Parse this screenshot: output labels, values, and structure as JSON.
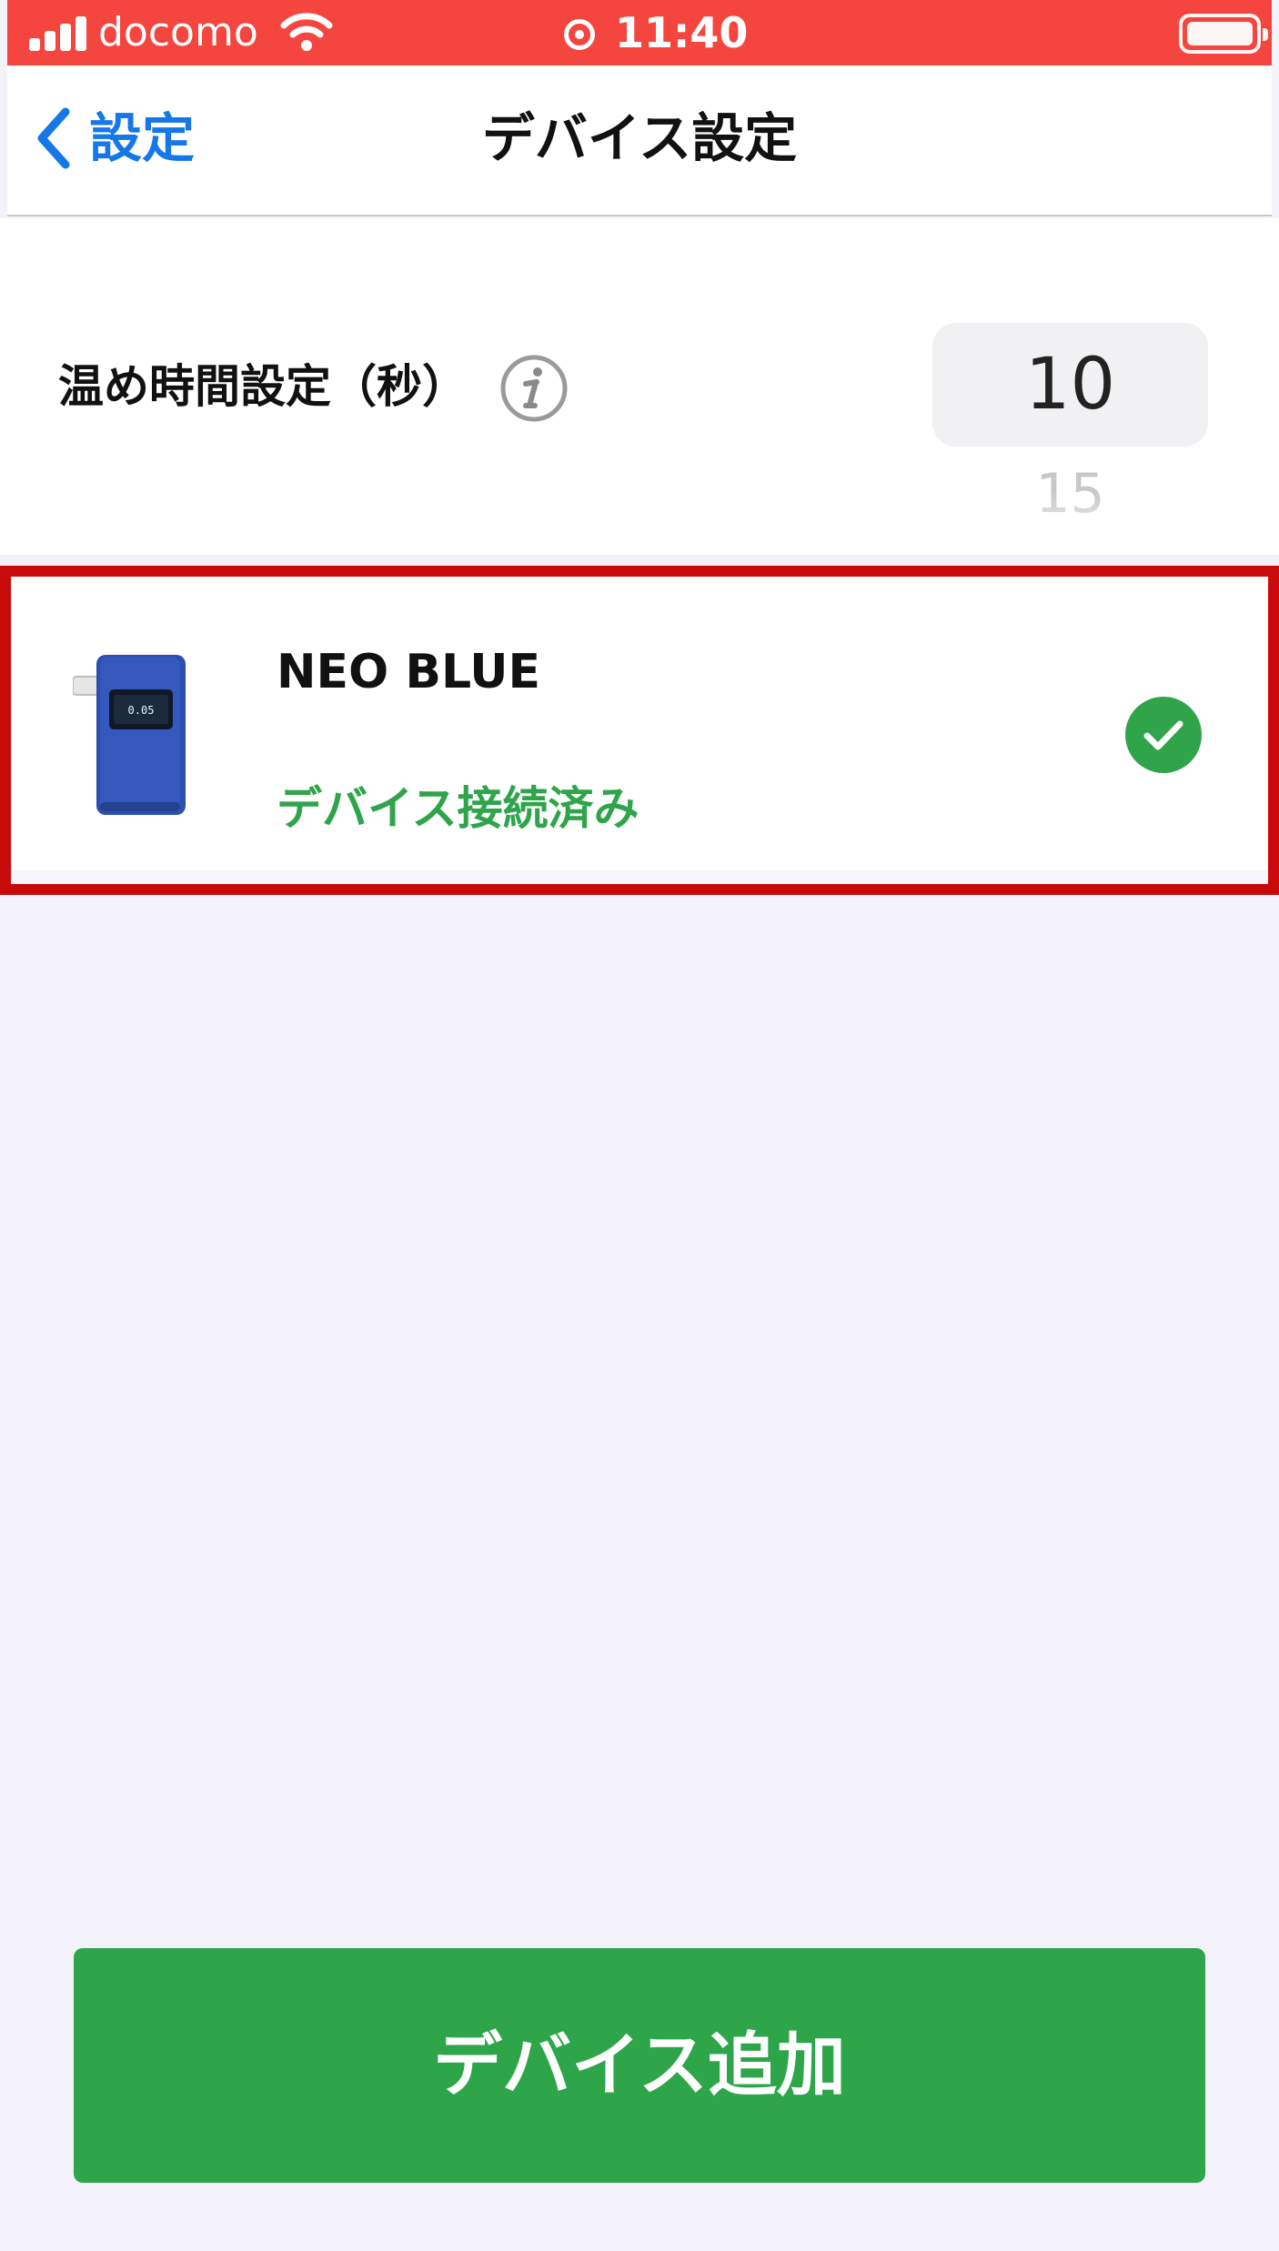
{
  "status_bar": {
    "carrier": "docomo",
    "time": "11:40",
    "icons": [
      "signal-icon",
      "wifi-icon",
      "screen-record-icon",
      "battery-icon"
    ]
  },
  "nav": {
    "back_label": "設定",
    "title": "デバイス設定"
  },
  "warmup": {
    "label": "温め時間設定（秒）",
    "selected_value": "10",
    "next_value": "15"
  },
  "device": {
    "name": "NEO BLUE",
    "status": "デバイス接続済み",
    "device_screen_text": "0.05",
    "connected": true
  },
  "add_button": {
    "label": "デバイス追加"
  },
  "colors": {
    "status_bar": "#f4463f",
    "link": "#1677e8",
    "success": "#2fa44a",
    "button": "#2ea548",
    "highlight": "#c80a0a",
    "background": "#f3f2fa"
  }
}
